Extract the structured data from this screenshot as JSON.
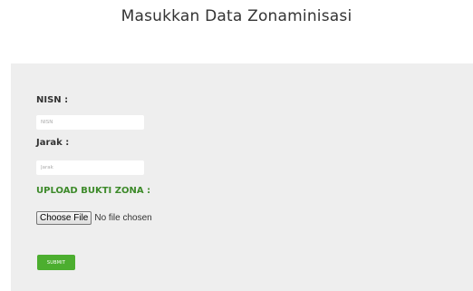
{
  "page": {
    "title": "Masukkan Data Zonaminisasi"
  },
  "form": {
    "nisn_label": "NISN :",
    "nisn_placeholder": "NISN",
    "nisn_value": "",
    "jarak_label": "Jarak :",
    "jarak_placeholder": "Jarak",
    "jarak_value": "",
    "upload_label": "UPLOAD BUKTI ZONA :",
    "file_button_label": "Choose File",
    "file_status": "No file chosen",
    "submit_label": "SUBMIT"
  },
  "colors": {
    "panel_background": "#eeeeee",
    "upload_label": "#3d8a2a",
    "submit_button": "#4cae2f"
  }
}
